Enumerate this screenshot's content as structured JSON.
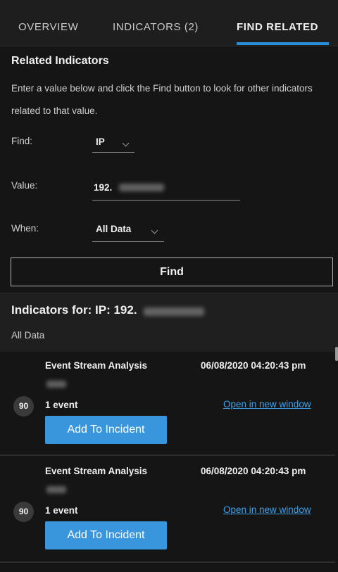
{
  "tabs": [
    {
      "label": "OVERVIEW",
      "active": false
    },
    {
      "label": "INDICATORS (2)",
      "active": false
    },
    {
      "label": "FIND RELATED",
      "active": true
    }
  ],
  "accent_color": "#2a8fd8",
  "find_section": {
    "title": "Related Indicators",
    "description": "Enter a value below and click the Find button to look for other indicators related to that value.",
    "find_label": "Find:",
    "find_value": "IP",
    "value_label": "Value:",
    "value_text": "192.",
    "when_label": "When:",
    "when_value": "All Data",
    "find_button": "Find"
  },
  "results": {
    "title": "Indicators for: IP: 192.",
    "subtitle": "All Data",
    "items": [
      {
        "source": "Event Stream Analysis",
        "timestamp": "06/08/2020 04:20:43 pm",
        "score": "90",
        "events": "1 event",
        "open_link": "Open in new window",
        "add_button": "Add To Incident"
      },
      {
        "source": "Event Stream Analysis",
        "timestamp": "06/08/2020 04:20:43 pm",
        "score": "90",
        "events": "1 event",
        "open_link": "Open in new window",
        "add_button": "Add To Incident"
      }
    ]
  }
}
